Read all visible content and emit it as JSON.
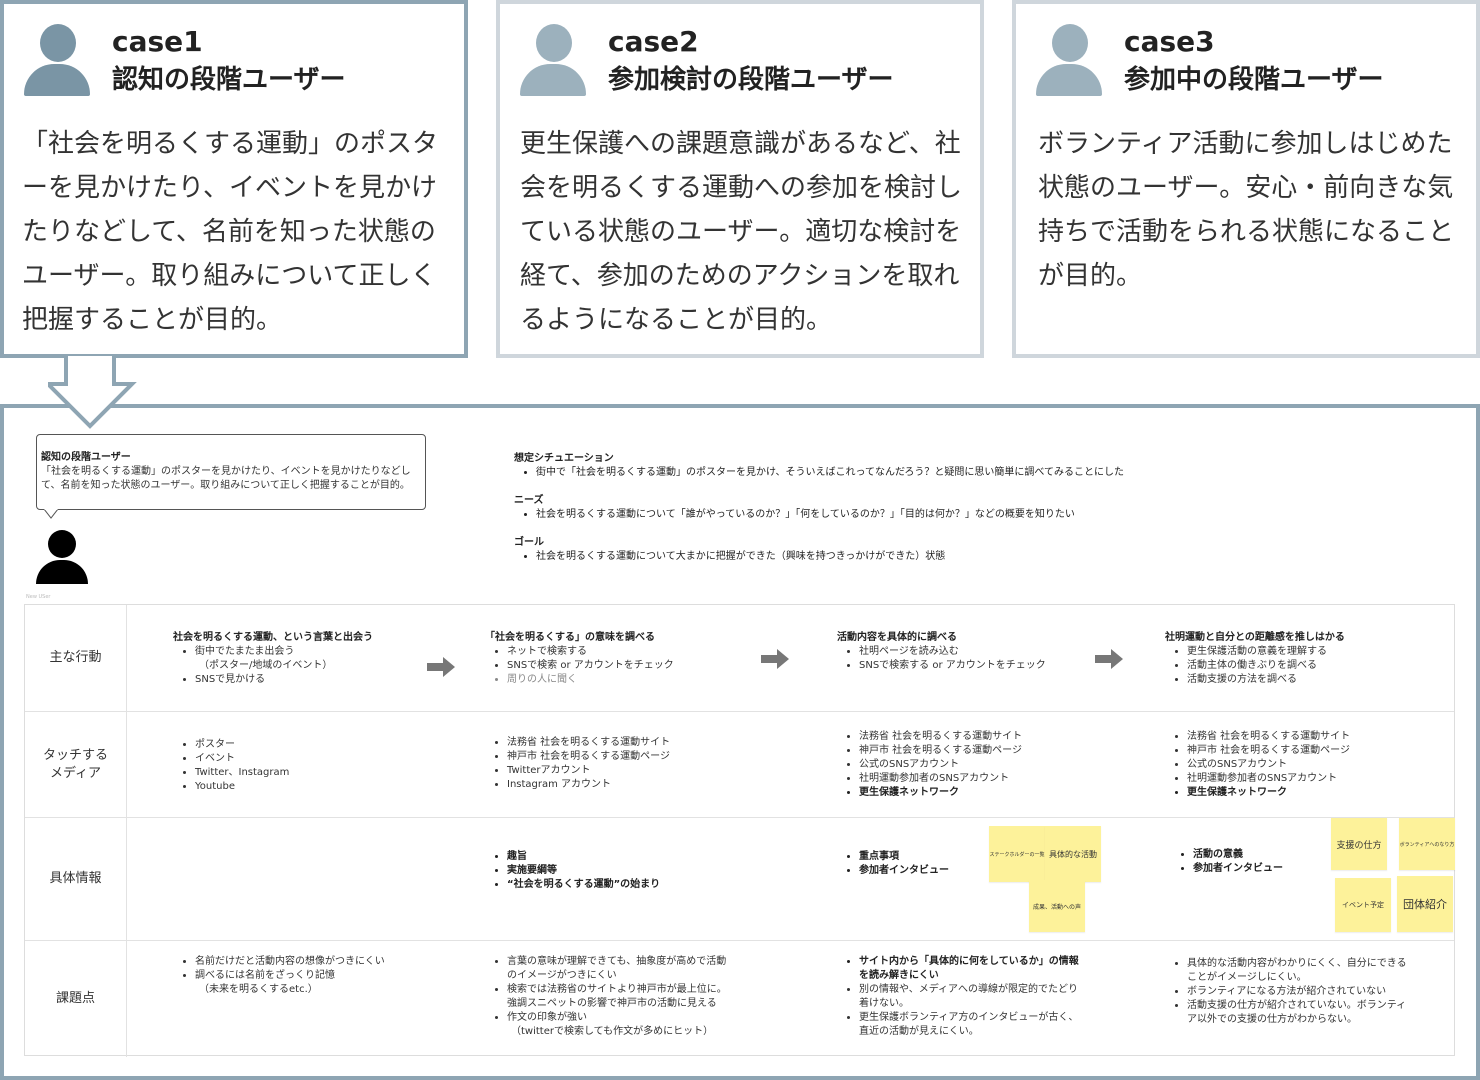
{
  "cases": [
    {
      "no": "case1",
      "name": "認知の段階ユーザー",
      "desc": "「社会を明るくする運動」のポスターを見かけたり、イベントを見かけたりなどして、名前を知った状態のユーザー。取り組みについて正しく把握することが目的。"
    },
    {
      "no": "case2",
      "name": "参加検討の段階ユーザー",
      "desc": "更生保護への課題意識があるなど、社会を明るくする運動への参加を検討している状態のユーザー。適切な検討を経て、参加のためのアクションを取れるようになることが目的。"
    },
    {
      "no": "case3",
      "name": "参加中の段階ユーザー",
      "desc": "ボランティア活動に参加しはじめた状態のユーザー。安心・前向きな気持ちで活動をられる状態になることが目的。"
    }
  ],
  "persona": {
    "title": "認知の段階ユーザー",
    "text": "「社会を明るくする運動」のポスターを見かけたり、イベントを見かけたりなどして、名前を知った状態のユーザー。取り組みについて正しく把握することが目的。",
    "note": "New USer"
  },
  "scenario": {
    "situation_h": "想定シチュエーション",
    "situation": "街中で「社会を明るくする運動」のポスターを見かけ、そういえばこれってなんだろう？と疑問に思い簡単に調べてみることにした",
    "needs_h": "ニーズ",
    "needs": "社会を明るくする運動について「誰がやっているのか？」「何をしているのか？」「目的は何か？」などの概要を知りたい",
    "goal_h": "ゴール",
    "goal": "社会を明るくする運動について大まかに把握ができた（興味を持つきっかけができた）状態"
  },
  "rows": {
    "actions": "主な行動",
    "media": "タッチする\nメディア",
    "info": "具体情報",
    "issues": "課題点"
  },
  "actions": [
    {
      "title": "社会を明るくする運動、という言葉と出会う",
      "items": [
        "街中でたまたま出会う",
        "（ポスター/地域のイベント）",
        "SNSで見かける"
      ]
    },
    {
      "title": "「社会を明るくする」の意味を調べる",
      "items": [
        "ネットで検索する",
        "SNSで検索 or アカウントをチェック",
        "周りの人に聞く"
      ]
    },
    {
      "title": "活動内容を具体的に調べる",
      "items": [
        "社明ページを読み込む",
        "SNSで検索する or アカウントをチェック"
      ]
    },
    {
      "title": "社明運動と自分との距離感を推しはかる",
      "items": [
        "更生保護活動の意義を理解する",
        "活動主体の働きぶりを調べる",
        "活動支援の方法を調べる"
      ]
    }
  ],
  "media": [
    [
      "ポスター",
      "イベント",
      "Twitter、Instagram",
      "Youtube"
    ],
    [
      "法務省 社会を明るくする運動サイト",
      "神戸市 社会を明るくする運動ページ",
      "Twitterアカウント",
      "Instagram アカウント"
    ],
    [
      "法務省 社会を明るくする運動サイト",
      "神戸市 社会を明るくする運動ページ",
      "公式のSNSアカウント",
      "社明運動参加者のSNSアカウント",
      "更生保護ネットワーク"
    ],
    [
      "法務省 社会を明るくする運動サイト",
      "神戸市 社会を明るくする運動ページ",
      "公式のSNSアカウント",
      "社明運動参加者のSNSアカウント",
      "更生保護ネットワーク"
    ]
  ],
  "info": [
    [],
    [
      "趣旨",
      "実施要綱等",
      "“社会を明るくする運動”の始まり"
    ],
    [
      "重点事項",
      "参加者インタビュー"
    ],
    [
      "活動の意義",
      "参加者インタビュー"
    ]
  ],
  "stickies": {
    "s1": "ステークホルダーの一覧",
    "s2": "具体的な活動",
    "s3": "成果、活動への声",
    "s4": "支援の仕方",
    "s5": "ボランティアへのなり方",
    "s6": "イベント予定",
    "s7": "団体紹介"
  },
  "issues": [
    [
      "名前だけだと活動内容の想像がつきにくい",
      "調べるには名前をざっくり記憶",
      "（未来を明るくするetc.）"
    ],
    [
      "言葉の意味が理解できても、抽象度が高めで活動",
      "のイメージがつきにくい",
      "検索では法務省のサイトより神戸市が最上位に。",
      "強調スニペットの影響で神戸市の活動に見える",
      "作文の印象が強い",
      "（twitterで検索しても作文が多めにヒット）"
    ],
    [
      "サイト内から「具体的に何をしているか」の情報",
      "を読み解きにくい",
      "別の情報や、メディアへの導線が限定的でたどり",
      "着けない。",
      "更生保護ボランティア方のインタビューが古く、",
      "直近の活動が見えにくい。"
    ],
    [
      "具体的な活動内容がわかりにくく、自分にできる",
      "ことがイメージしにくい。",
      "ボランティアになる方法が紹介されていない",
      "活動支援の仕方が紹介されていない。ボランティ",
      "ア以外での支援の仕方がわからない。"
    ]
  ]
}
